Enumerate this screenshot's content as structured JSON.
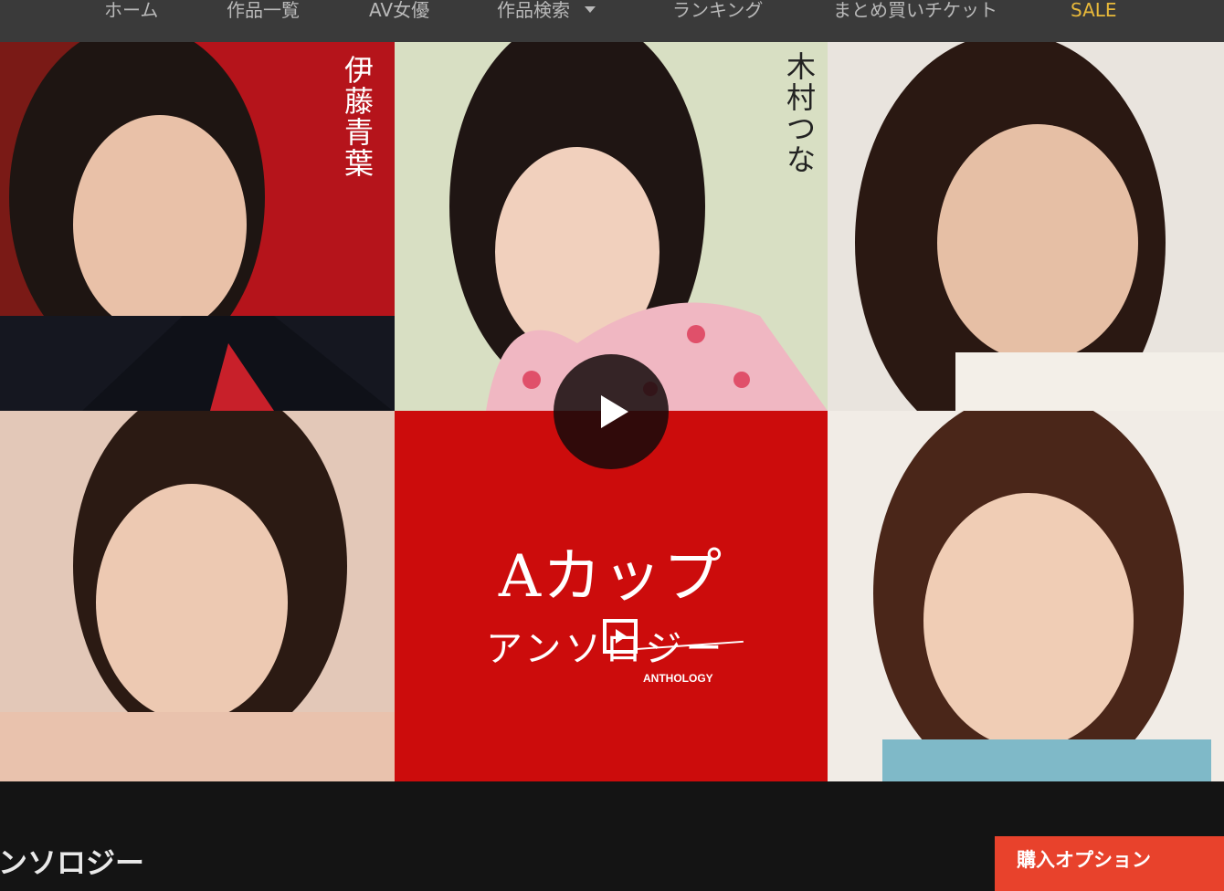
{
  "nav": {
    "items": [
      {
        "label": "ホーム"
      },
      {
        "label": "作品一覧"
      },
      {
        "label": "AV女優"
      },
      {
        "label": "作品検索"
      },
      {
        "label": "ランキング"
      },
      {
        "label": "まとめ買いチケット"
      },
      {
        "label": "SALE"
      }
    ],
    "colors": {
      "text": "#b9b9b9",
      "sale": "#e8b93a",
      "background": "#3a3a3a"
    }
  },
  "hero": {
    "tiles": [
      {
        "name_label": "伊藤青葉",
        "name_color": "#ffffff"
      },
      {
        "name_label": "木村つな",
        "name_color": "#222222"
      }
    ],
    "logo": {
      "main": "Aカップ",
      "sub": "アンソロジー",
      "en": "ANTHOLOGY"
    },
    "play_icon": "play-icon",
    "accent": "#cc0c0c"
  },
  "footer": {
    "title": "ンソロジー",
    "buy_label": "購入オプション",
    "buy_color": "#e8422c"
  }
}
